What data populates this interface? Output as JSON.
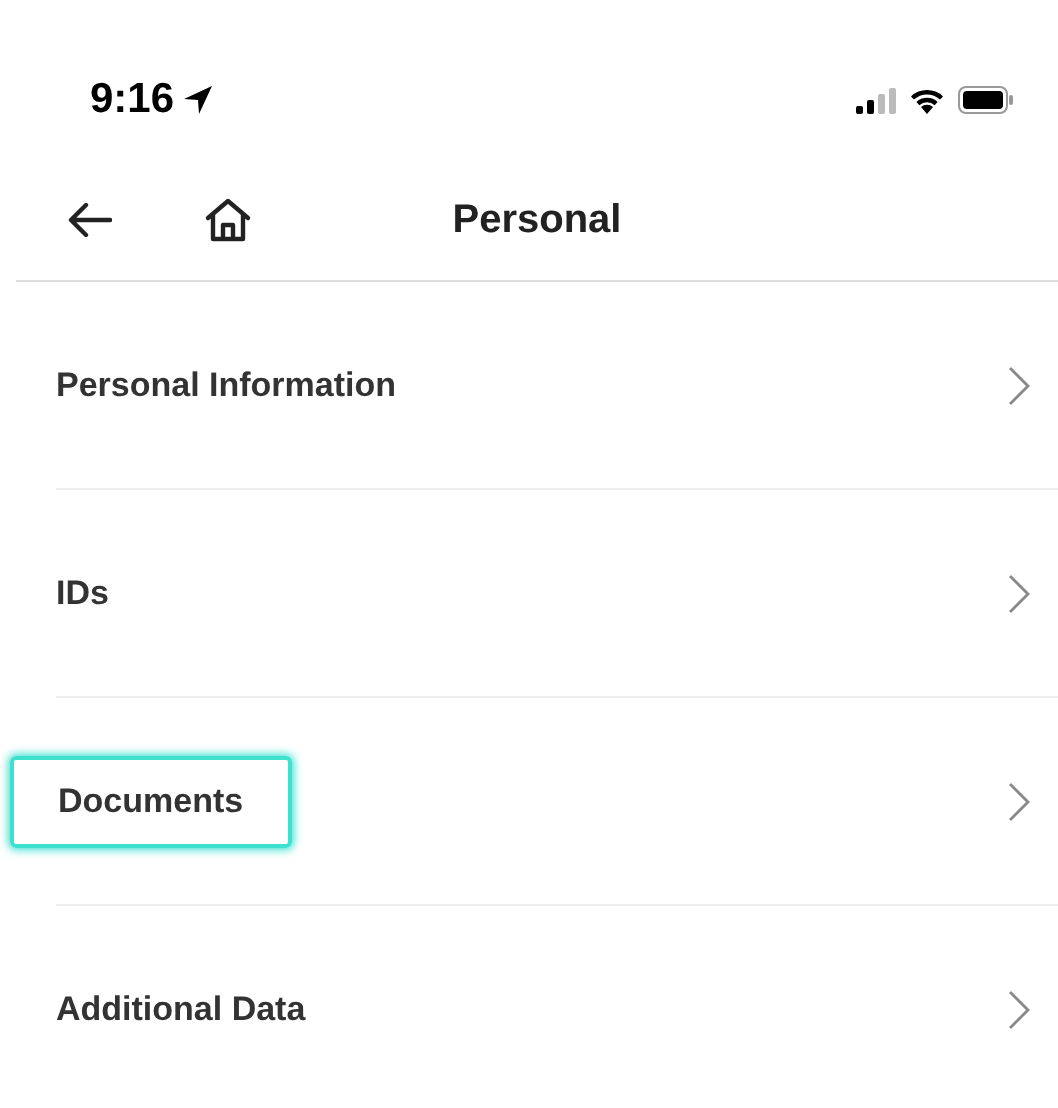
{
  "status_bar": {
    "time": "9:16"
  },
  "nav": {
    "title": "Personal"
  },
  "items": [
    {
      "label": "Personal Information",
      "selected": false
    },
    {
      "label": "IDs",
      "selected": false
    },
    {
      "label": "Documents",
      "selected": true
    },
    {
      "label": "Additional Data",
      "selected": false
    }
  ]
}
